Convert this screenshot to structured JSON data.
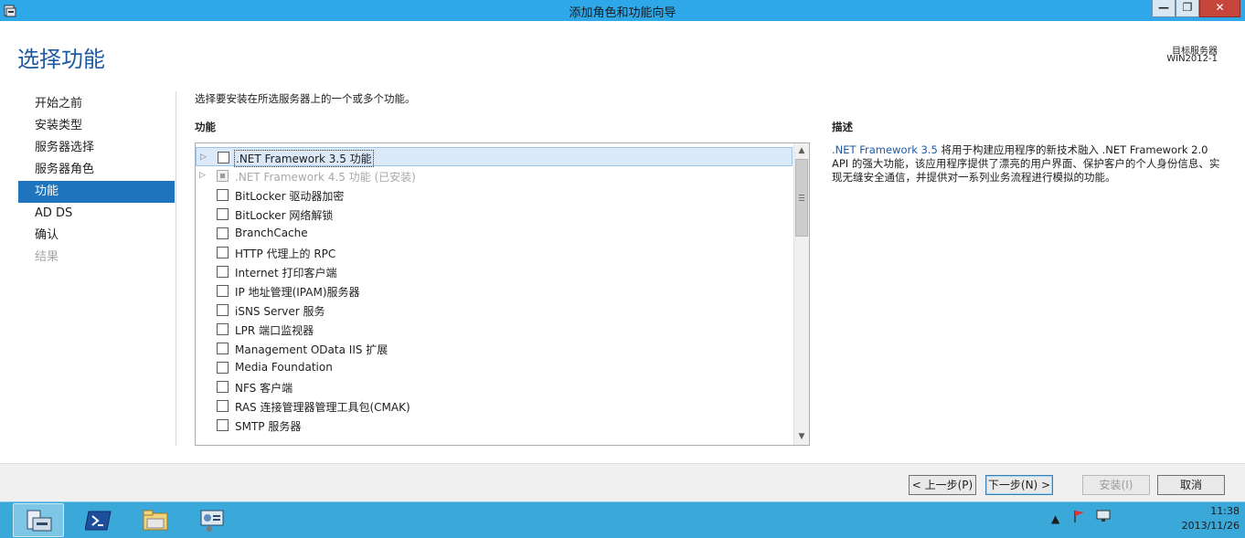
{
  "window": {
    "title": "添加角色和功能向导",
    "min_glyph": "—",
    "max_glyph": "❐",
    "close_glyph": "✕"
  },
  "header": {
    "page_title": "选择功能",
    "target_label": "目标服务器",
    "target_value": "WIN2012-1"
  },
  "nav": {
    "items": [
      {
        "label": "开始之前",
        "state": "normal"
      },
      {
        "label": "安装类型",
        "state": "normal"
      },
      {
        "label": "服务器选择",
        "state": "normal"
      },
      {
        "label": "服务器角色",
        "state": "normal"
      },
      {
        "label": "功能",
        "state": "active"
      },
      {
        "label": "AD DS",
        "state": "normal"
      },
      {
        "label": "确认",
        "state": "normal"
      },
      {
        "label": "结果",
        "state": "disabled"
      }
    ]
  },
  "main": {
    "instruction": "选择要安装在所选服务器上的一个或多个功能。",
    "features_heading": "功能",
    "description_heading": "描述",
    "features": [
      {
        "label": ".NET Framework 3.5 功能",
        "expandable": true,
        "checked": false,
        "selected": true,
        "disabled": false
      },
      {
        "label": ".NET Framework 4.5 功能 (已安装)",
        "expandable": true,
        "checked": false,
        "selected": false,
        "disabled": true
      },
      {
        "label": "BitLocker 驱动器加密",
        "expandable": false,
        "checked": false,
        "selected": false,
        "disabled": false
      },
      {
        "label": "BitLocker 网络解锁",
        "expandable": false,
        "checked": false,
        "selected": false,
        "disabled": false
      },
      {
        "label": "BranchCache",
        "expandable": false,
        "checked": false,
        "selected": false,
        "disabled": false
      },
      {
        "label": "HTTP 代理上的 RPC",
        "expandable": false,
        "checked": false,
        "selected": false,
        "disabled": false
      },
      {
        "label": "Internet 打印客户端",
        "expandable": false,
        "checked": false,
        "selected": false,
        "disabled": false
      },
      {
        "label": "IP 地址管理(IPAM)服务器",
        "expandable": false,
        "checked": false,
        "selected": false,
        "disabled": false
      },
      {
        "label": "iSNS Server 服务",
        "expandable": false,
        "checked": false,
        "selected": false,
        "disabled": false
      },
      {
        "label": "LPR 端口监视器",
        "expandable": false,
        "checked": false,
        "selected": false,
        "disabled": false
      },
      {
        "label": "Management OData IIS 扩展",
        "expandable": false,
        "checked": false,
        "selected": false,
        "disabled": false
      },
      {
        "label": "Media Foundation",
        "expandable": false,
        "checked": false,
        "selected": false,
        "disabled": false
      },
      {
        "label": "NFS 客户端",
        "expandable": false,
        "checked": false,
        "selected": false,
        "disabled": false
      },
      {
        "label": "RAS 连接管理器管理工具包(CMAK)",
        "expandable": false,
        "checked": false,
        "selected": false,
        "disabled": false
      },
      {
        "label": "SMTP 服务器",
        "expandable": false,
        "checked": false,
        "selected": false,
        "disabled": false
      }
    ],
    "description": {
      "link_text": ".NET Framework 3.5",
      "text": " 将用于构建应用程序的新技术融入 .NET Framework 2.0 API 的强大功能，该应用程序提供了漂亮的用户界面、保护客户的个人身份信息、实现无缝安全通信，并提供对一系列业务流程进行模拟的功能。"
    }
  },
  "footer": {
    "prev": "< 上一步(P)",
    "next": "下一步(N) >",
    "install": "安装(I)",
    "cancel": "取消"
  },
  "taskbar": {
    "time": "11:38",
    "date": "2013/11/26",
    "tray_arrow": "▲"
  },
  "colors": {
    "titlebar": "#2ea8e8",
    "accent": "#1e74bd",
    "title_text": "#1e5aa3",
    "taskbar": "#3aa8d8"
  }
}
